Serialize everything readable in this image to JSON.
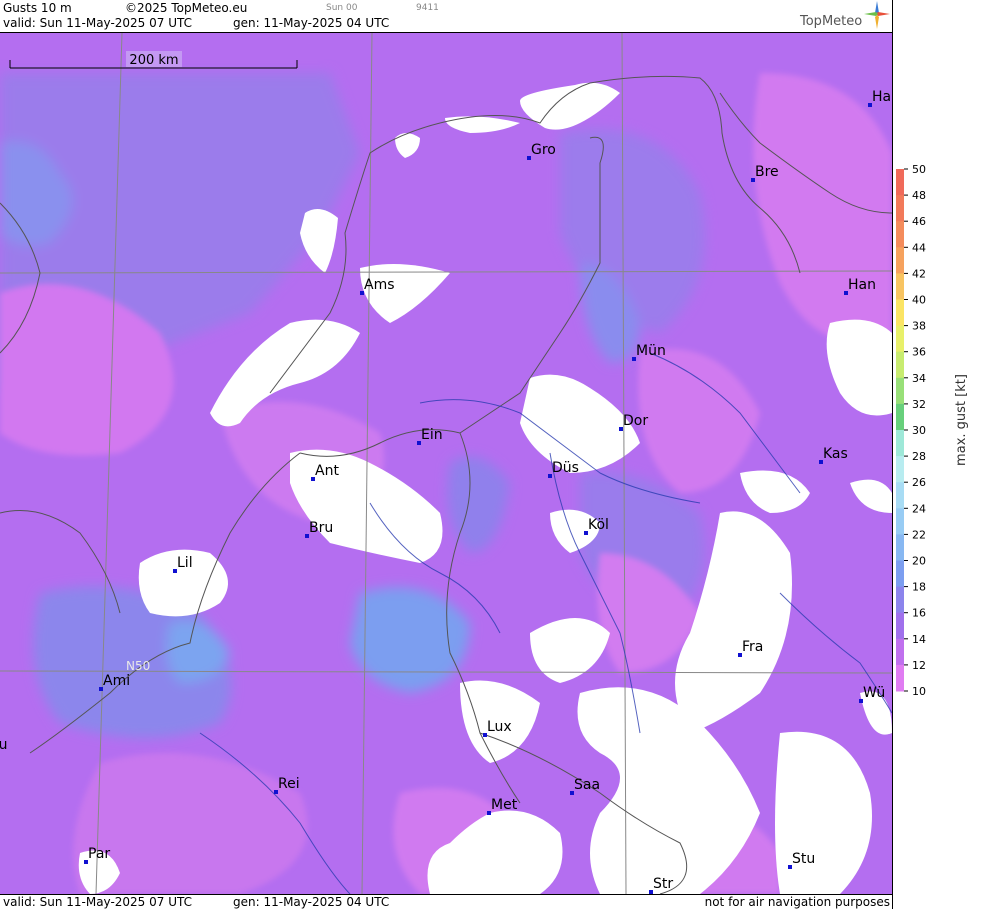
{
  "header": {
    "product": "Gusts 10 m",
    "copyright": "©2025 TopMeteo.eu",
    "run_tag": "Sun 00",
    "code_tag": "9411",
    "valid": "valid:  Sun  11-May-2025  07 UTC",
    "gen": "gen: 11-May-2025 04 UTC",
    "brand": "TopMeteo"
  },
  "footer": {
    "valid": "valid:  Sun  11-May-2025  07 UTC",
    "gen": "gen: 11-May-2025 04 UTC",
    "disclaimer": "not for air navigation purposes"
  },
  "map": {
    "scale_label": "200 km",
    "lat_label": "N50",
    "cities": [
      {
        "name": "Ha"
      },
      {
        "name": "Gro"
      },
      {
        "name": "Bre"
      },
      {
        "name": "Ams"
      },
      {
        "name": "Han"
      },
      {
        "name": "Mün"
      },
      {
        "name": "Dor"
      },
      {
        "name": "Ein"
      },
      {
        "name": "Ant"
      },
      {
        "name": "Düs"
      },
      {
        "name": "Kas"
      },
      {
        "name": "Bru"
      },
      {
        "name": "Köl"
      },
      {
        "name": "Lil"
      },
      {
        "name": "Fra"
      },
      {
        "name": "Ami"
      },
      {
        "name": "Wü"
      },
      {
        "name": "Lux"
      },
      {
        "name": "ou"
      },
      {
        "name": "Rei"
      },
      {
        "name": "Saa"
      },
      {
        "name": "Met"
      },
      {
        "name": "Par"
      },
      {
        "name": "Stu"
      },
      {
        "name": "Str"
      }
    ]
  },
  "legend": {
    "title": "max. gust [kt]",
    "ticks": [
      "50",
      "48",
      "46",
      "44",
      "42",
      "40",
      "38",
      "36",
      "34",
      "32",
      "30",
      "28",
      "26",
      "24",
      "22",
      "20",
      "18",
      "16",
      "14",
      "12",
      "10"
    ],
    "colors": {
      "50": "#f06a5a",
      "48": "#f27a5a",
      "46": "#f48c5c",
      "44": "#f6a25e",
      "42": "#f8c462",
      "40": "#fbe464",
      "38": "#e8f06a",
      "36": "#c8ec70",
      "34": "#98e078",
      "32": "#68d07c",
      "30": "#9ee8d8",
      "28": "#b8ecf0",
      "26": "#a8dcf4",
      "24": "#98ccf4",
      "22": "#88b8f2",
      "20": "#7c9ef0",
      "18": "#8c84ec",
      "16": "#a070ec",
      "14": "#c070ee",
      "12": "#e07cf2"
    }
  }
}
